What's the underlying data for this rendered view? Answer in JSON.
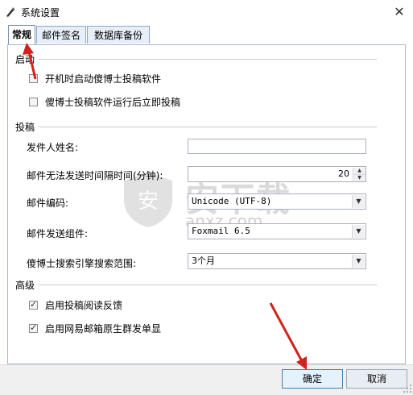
{
  "window": {
    "title": "系统设置",
    "close_glyph": "✕"
  },
  "tabs": [
    {
      "label": "常规",
      "active": true
    },
    {
      "label": "邮件签名",
      "active": false
    },
    {
      "label": "数据库备份",
      "active": false
    }
  ],
  "groups": {
    "startup": {
      "label": "启动",
      "options": [
        {
          "label": "开机时启动傻博士投稿软件",
          "checked": false
        },
        {
          "label": "傻博士投稿软件运行后立即投稿",
          "checked": false
        }
      ]
    },
    "submission": {
      "label": "投稿",
      "sender_name": {
        "label": "发件人姓名:",
        "value": ""
      },
      "interval": {
        "label": "邮件无法发送时间隔时间(分钟):",
        "value": "20"
      },
      "encoding": {
        "label": "邮件编码:",
        "value": "Unicode (UTF-8)"
      },
      "component": {
        "label": "邮件发送组件:",
        "value": "Foxmail 6.5"
      },
      "search_range": {
        "label": "傻博士搜索引擎搜索范围:",
        "value": "3个月"
      }
    },
    "advanced": {
      "label": "高级",
      "options": [
        {
          "label": "启用投稿阅读反馈",
          "checked": true
        },
        {
          "label": "启用网易邮箱原生群发单显",
          "checked": true
        }
      ]
    }
  },
  "buttons": {
    "ok": "确定",
    "cancel": "取消"
  },
  "watermark": {
    "main": "安下载",
    "sub": "anxz.com",
    "shield_char": "安"
  },
  "colors": {
    "arrow": "#d0231c",
    "tab_border": "#8fa6c8",
    "primary_border": "#3c7fb1"
  }
}
